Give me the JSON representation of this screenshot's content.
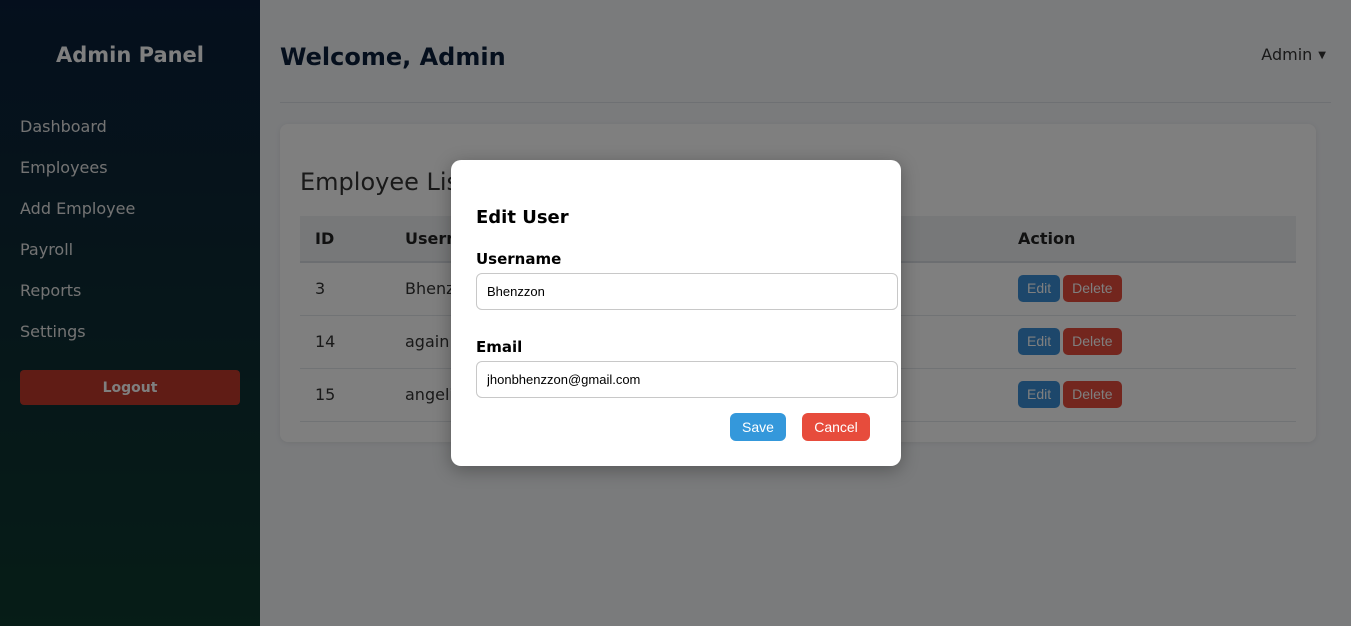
{
  "sidebar": {
    "brand": "Admin Panel",
    "items": [
      "Dashboard",
      "Employees",
      "Add Employee",
      "Payroll",
      "Reports",
      "Settings"
    ],
    "logout": "Logout"
  },
  "header": {
    "welcome": "Welcome, Admin",
    "user_menu": "Admin",
    "caret": "▼"
  },
  "employee_list": {
    "title": "Employee List",
    "columns": [
      "ID",
      "Username",
      "Action"
    ],
    "rows": [
      {
        "id": "3",
        "username": "Bhenzzon"
      },
      {
        "id": "14",
        "username": "again"
      },
      {
        "id": "15",
        "username": "angelica"
      }
    ],
    "edit_label": "Edit",
    "delete_label": "Delete"
  },
  "modal": {
    "title": "Edit User",
    "username_label": "Username",
    "username_value": "Bhenzzon",
    "email_label": "Email",
    "email_value": "jhonbhenzzon@gmail.com",
    "save_label": "Save",
    "cancel_label": "Cancel"
  }
}
